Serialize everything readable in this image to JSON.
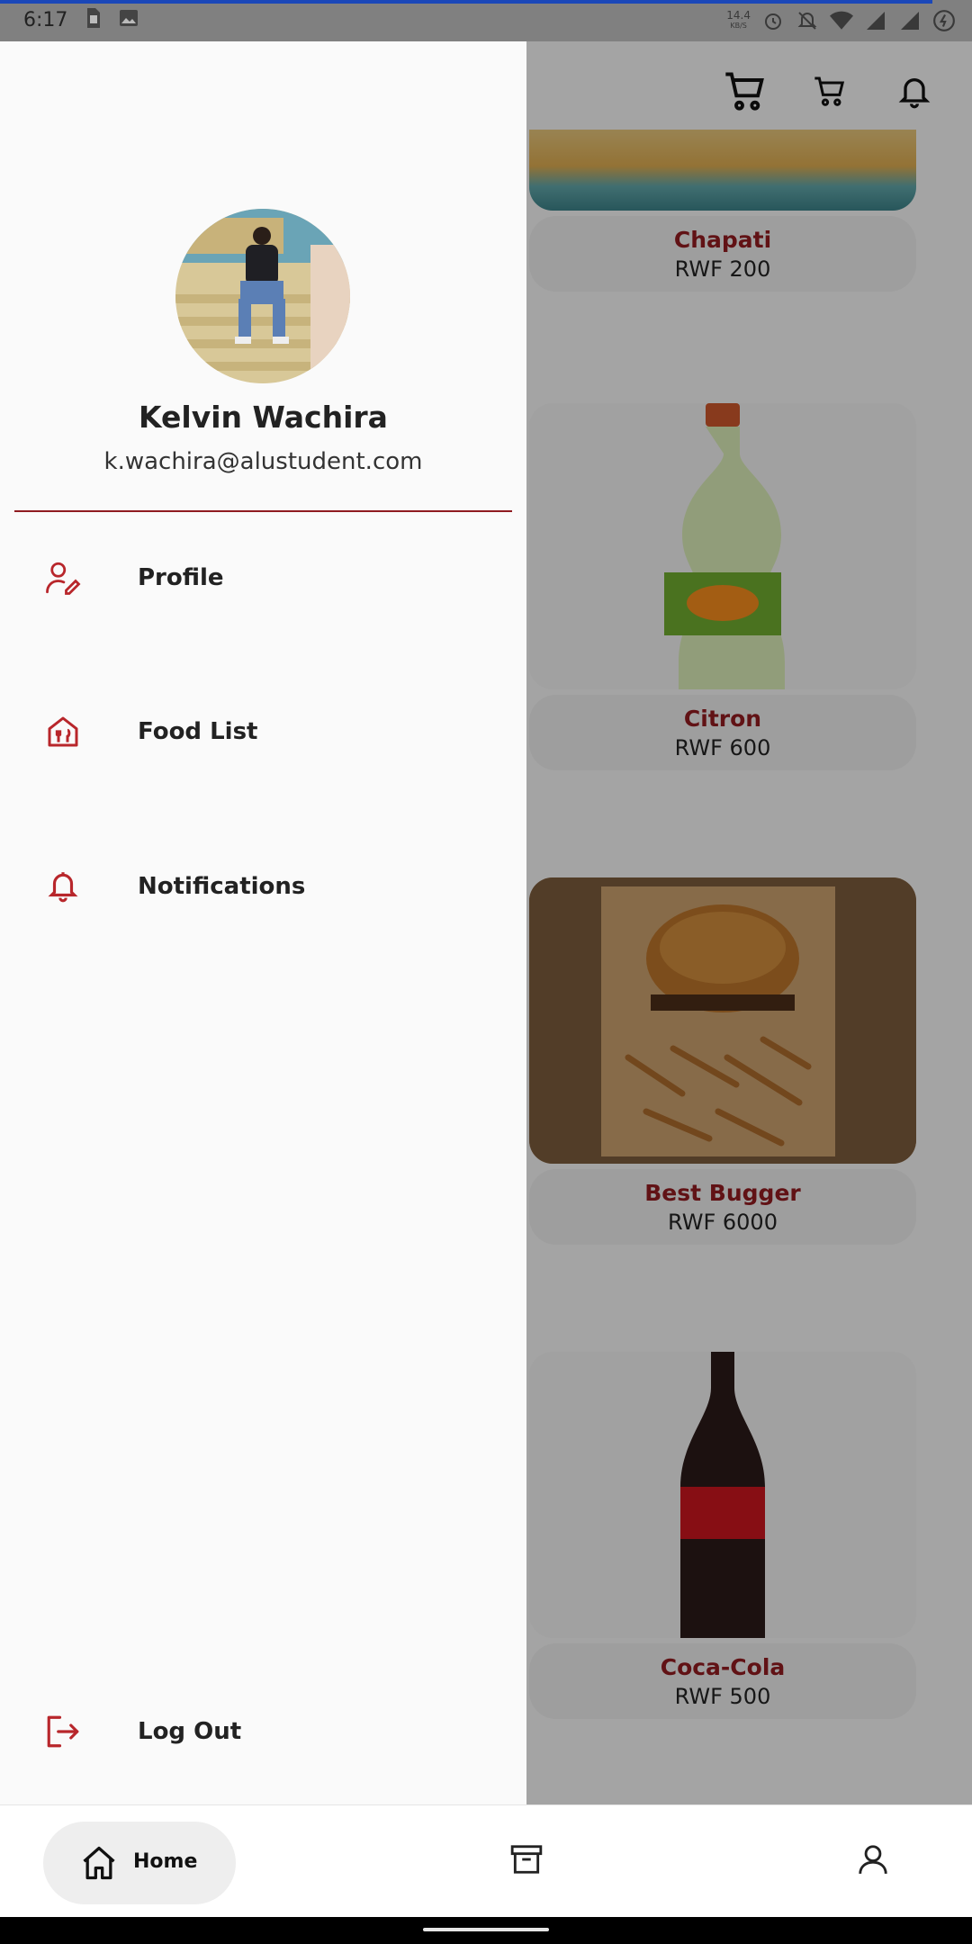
{
  "status_bar": {
    "time": "6:17",
    "net_speed_value": "14.4",
    "net_speed_unit": "KB/S",
    "icons": [
      "sim-card-icon",
      "image-icon",
      "alarm-icon",
      "mute-icon",
      "wifi-icon",
      "signal-icon",
      "signal-icon-2",
      "battery-icon"
    ]
  },
  "top_bar": {
    "icons": [
      "cart-large-icon",
      "cart-small-icon",
      "bell-icon"
    ]
  },
  "food_items": [
    {
      "name": "Chapati",
      "price": "RWF 200"
    },
    {
      "name": "Citron",
      "price": "RWF 600"
    },
    {
      "name": "Best Bugger",
      "price": "RWF 6000"
    },
    {
      "name": "Coca-Cola",
      "price": "RWF 500"
    }
  ],
  "drawer": {
    "user_name": "Kelvin Wachira",
    "user_email": "k.wachira@alustudent.com",
    "menu": [
      {
        "label": "Profile",
        "icon": "profile-edit-icon"
      },
      {
        "label": "Food List",
        "icon": "restaurant-icon"
      },
      {
        "label": "Notifications",
        "icon": "bell-icon"
      }
    ],
    "logout_label": "Log Out"
  },
  "bottom_nav": {
    "home_label": "Home",
    "items": [
      "home-icon",
      "archive-icon",
      "user-icon"
    ]
  },
  "colors": {
    "accent": "#8f1b20",
    "drawer_bg": "#fafafa"
  }
}
